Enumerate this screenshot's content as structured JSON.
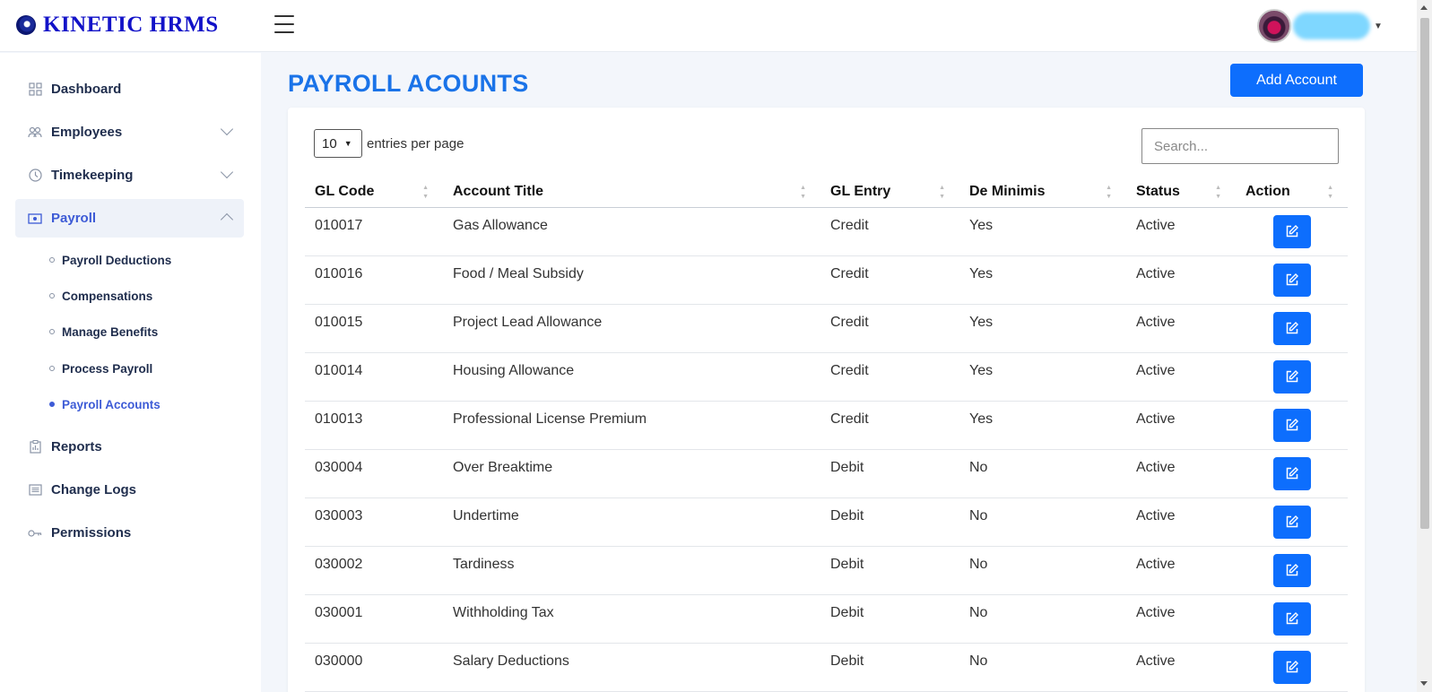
{
  "app": {
    "brand": "KINETIC HRMS"
  },
  "sidebar": {
    "items": [
      {
        "label": "Dashboard",
        "icon": "grid-icon"
      },
      {
        "label": "Employees",
        "icon": "users-icon"
      },
      {
        "label": "Timekeeping",
        "icon": "clock-icon"
      },
      {
        "label": "Payroll",
        "icon": "money-icon"
      },
      {
        "label": "Reports",
        "icon": "report-icon"
      },
      {
        "label": "Change Logs",
        "icon": "list-icon"
      },
      {
        "label": "Permissions",
        "icon": "key-icon"
      }
    ],
    "payroll_sub": [
      {
        "label": "Payroll Deductions"
      },
      {
        "label": "Compensations"
      },
      {
        "label": "Manage Benefits"
      },
      {
        "label": "Process Payroll"
      },
      {
        "label": "Payroll Accounts"
      }
    ]
  },
  "main": {
    "title": "PAYROLL ACOUNTS",
    "add_button": "Add Account",
    "entries_value": "10",
    "entries_text": "entries per page",
    "search_placeholder": "Search..."
  },
  "table": {
    "headers": [
      "GL Code",
      "Account Title",
      "GL Entry",
      "De Minimis",
      "Status",
      "Action"
    ],
    "rows": [
      {
        "code": "010017",
        "title": "Gas Allowance",
        "entry": "Credit",
        "deminimis": "Yes",
        "status": "Active"
      },
      {
        "code": "010016",
        "title": "Food / Meal Subsidy",
        "entry": "Credit",
        "deminimis": "Yes",
        "status": "Active"
      },
      {
        "code": "010015",
        "title": "Project Lead Allowance",
        "entry": "Credit",
        "deminimis": "Yes",
        "status": "Active"
      },
      {
        "code": "010014",
        "title": "Housing Allowance",
        "entry": "Credit",
        "deminimis": "Yes",
        "status": "Active"
      },
      {
        "code": "010013",
        "title": "Professional License Premium",
        "entry": "Credit",
        "deminimis": "Yes",
        "status": "Active"
      },
      {
        "code": "030004",
        "title": "Over Breaktime",
        "entry": "Debit",
        "deminimis": "No",
        "status": "Active"
      },
      {
        "code": "030003",
        "title": "Undertime",
        "entry": "Debit",
        "deminimis": "No",
        "status": "Active"
      },
      {
        "code": "030002",
        "title": "Tardiness",
        "entry": "Debit",
        "deminimis": "No",
        "status": "Active"
      },
      {
        "code": "030001",
        "title": "Withholding Tax",
        "entry": "Debit",
        "deminimis": "No",
        "status": "Active"
      },
      {
        "code": "030000",
        "title": "Salary Deductions",
        "entry": "Debit",
        "deminimis": "No",
        "status": "Active"
      }
    ]
  }
}
